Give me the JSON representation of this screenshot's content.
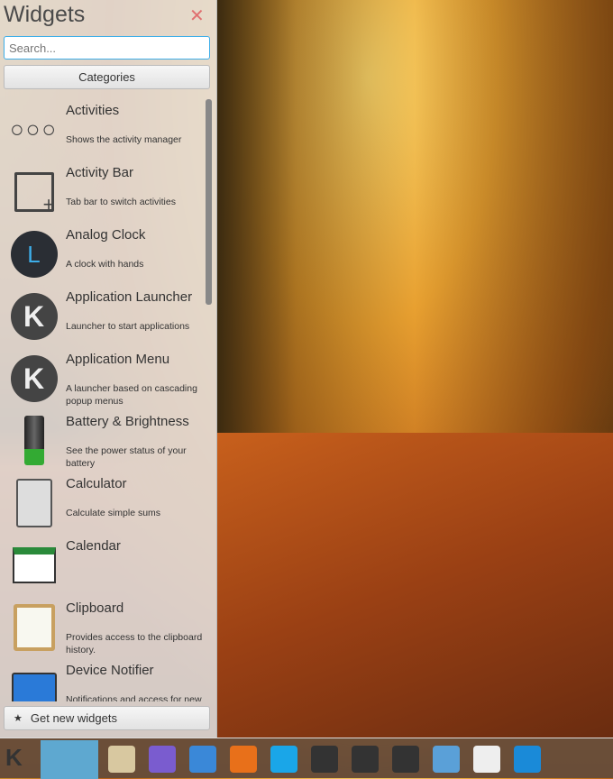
{
  "header": {
    "title": "Widgets",
    "close_icon": "close-icon"
  },
  "search": {
    "placeholder": "Search..."
  },
  "categories_label": "Categories",
  "widgets": [
    {
      "name": "Activities",
      "desc": "Shows the activity manager",
      "icon": "activities-icon"
    },
    {
      "name": "Activity Bar",
      "desc": "Tab bar to switch activities",
      "icon": "activity-bar-icon"
    },
    {
      "name": "Analog Clock",
      "desc": "A clock with hands",
      "icon": "clock-icon"
    },
    {
      "name": "Application Launcher",
      "desc": "Launcher to start applications",
      "icon": "kde-icon"
    },
    {
      "name": "Application Menu",
      "desc": "A launcher based on cascading popup menus",
      "icon": "kde-icon"
    },
    {
      "name": "Battery & Brightness",
      "desc": "See the power status of your battery",
      "icon": "battery-icon"
    },
    {
      "name": "Calculator",
      "desc": "Calculate simple sums",
      "icon": "calculator-icon"
    },
    {
      "name": "Calendar",
      "desc": "",
      "icon": "calendar-icon"
    },
    {
      "name": "Clipboard",
      "desc": "Provides access to the clipboard history.",
      "icon": "clipboard-icon"
    },
    {
      "name": "Device Notifier",
      "desc": "Notifications and access for new devices",
      "icon": "device-notifier-icon"
    }
  ],
  "get_new_label": "Get new widgets",
  "taskbar": {
    "colors": [
      "#d8c8a0",
      "#7a5ccf",
      "#3a88d8",
      "#e8701a",
      "#1aa6e8",
      "#333",
      "#333",
      "#333",
      "#5aa0d8",
      "#eee",
      "#1a8ad8"
    ]
  }
}
